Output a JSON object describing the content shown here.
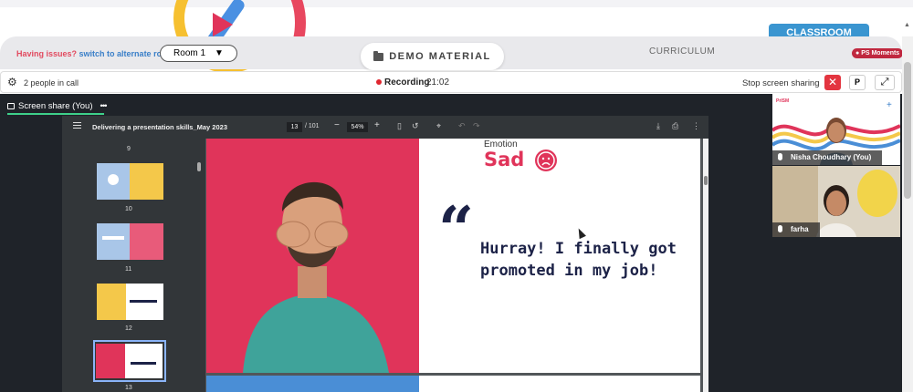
{
  "topbar": {
    "classroom_tab": "CLASSROOM"
  },
  "nav": {
    "issues_q": "Having issues?",
    "issues_link": "switch to alternate room",
    "room_value": "Room 1",
    "room_caret": "▼",
    "demo_material": "DEMO MATERIAL",
    "curriculum": "CURRICULUM",
    "ps_moments": "PS Moments"
  },
  "call": {
    "people": "2 people in call",
    "recording_label": "Recording",
    "recording_time": "21:02",
    "stop_share": "Stop screen sharing",
    "close_icon": "✕",
    "p_label": "P",
    "expand_icon": "⤢"
  },
  "share": {
    "tab_label": "Screen share (You)",
    "more": "•••"
  },
  "pdf": {
    "title": "Delivering a presentation skills_May 2023",
    "page_current": "13",
    "page_total": "/ 101",
    "zoom": "54%",
    "thumb_numbers": [
      "9",
      "10",
      "11",
      "12",
      "13"
    ],
    "selected_page": "13"
  },
  "slide": {
    "emotion_label": "Emotion",
    "emotion_value": "Sad",
    "quote_mark": "“",
    "quote_text": "Hurray! I finally got promoted in my job!"
  },
  "participants": [
    {
      "name": "Nisha Choudhary (You)"
    },
    {
      "name": "farha"
    }
  ],
  "colors": {
    "brand_red": "#e0345a",
    "brand_blue": "#3a95d0",
    "navy": "#1c2247",
    "recording": "#e0262f"
  }
}
